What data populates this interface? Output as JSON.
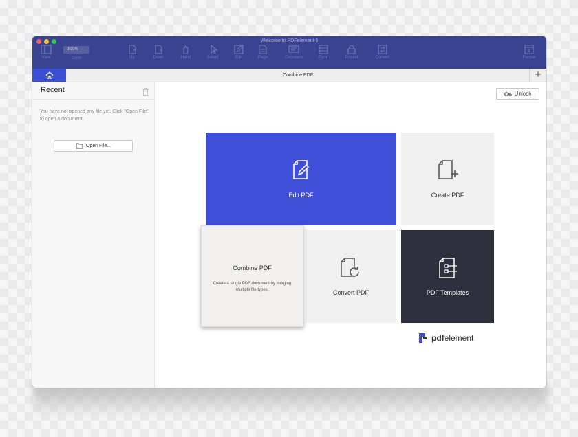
{
  "window": {
    "title": "Welcome to PDFelement 6",
    "traffic_lights": {
      "close": "#ff5f57",
      "minimize": "#febc2e",
      "zoom": "#28c840"
    }
  },
  "toolbar": {
    "zoom_value": "100%",
    "items": [
      {
        "label": "View",
        "icon": "sidebar-icon"
      },
      {
        "label": "Zoom",
        "icon": "zoom-icon"
      },
      {
        "label": "Up",
        "icon": "page-up-icon"
      },
      {
        "label": "Down",
        "icon": "page-down-icon"
      },
      {
        "label": "Hand",
        "icon": "hand-icon"
      },
      {
        "label": "Select",
        "icon": "cursor-icon"
      },
      {
        "label": "Edit",
        "icon": "edit-icon"
      },
      {
        "label": "Page",
        "icon": "page-icon"
      },
      {
        "label": "Comment",
        "icon": "comment-icon"
      },
      {
        "label": "Form",
        "icon": "form-icon"
      },
      {
        "label": "Protect",
        "icon": "lock-icon"
      },
      {
        "label": "Convert",
        "icon": "convert-icon"
      },
      {
        "label": "Format",
        "icon": "format-icon"
      }
    ]
  },
  "tabs": {
    "current_title": "Combine PDF",
    "add_label": "+"
  },
  "sidebar": {
    "heading": "Recent",
    "empty_message": "You have not opened any file yet. Click \"Open File\" to open a document.",
    "open_file_label": "Open File..."
  },
  "main": {
    "unlock_label": "Unlock",
    "cards": {
      "edit": "Edit PDF",
      "create": "Create PDF",
      "combine": "Combine PDF",
      "combine_desc": "Create a single PDF document by merging multiple file types.",
      "convert": "Convert PDF",
      "templates": "PDF Templates"
    },
    "brand": {
      "bold": "pdf",
      "rest": "element"
    }
  },
  "colors": {
    "titlebar": "#3a4391",
    "accent": "#3f4ed8",
    "dark_card": "#2e2f3c",
    "light_card": "#f0f0f0"
  }
}
